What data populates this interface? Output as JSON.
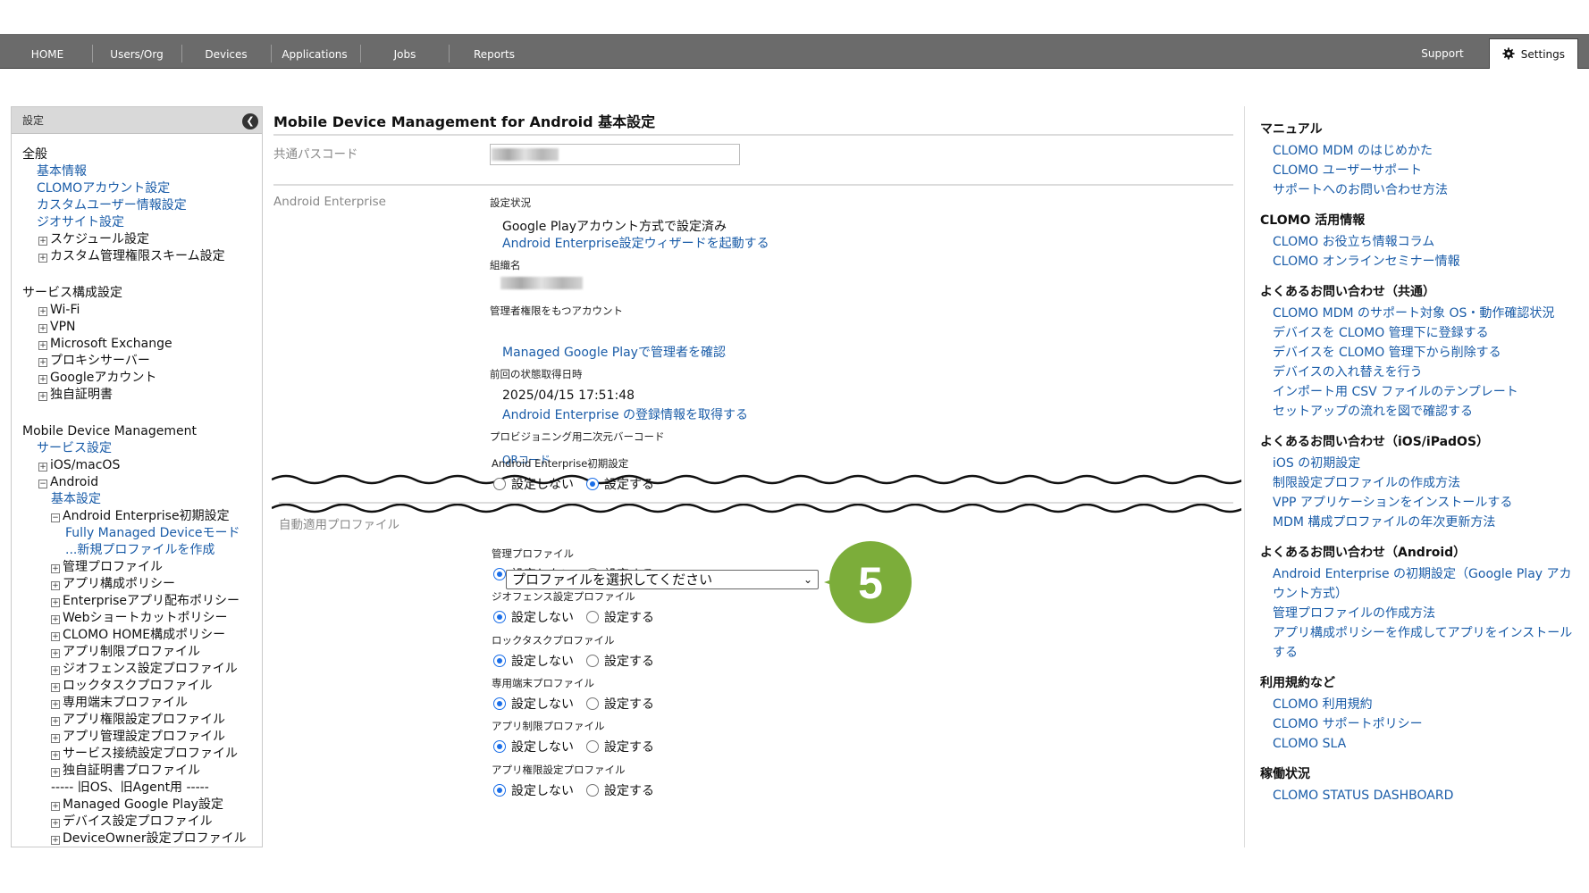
{
  "nav": {
    "items": [
      "HOME",
      "Users/Org",
      "Devices",
      "Applications",
      "Jobs",
      "Reports"
    ],
    "support": "Support",
    "settings": "Settings"
  },
  "sidebar": {
    "title": "設定",
    "sections": [
      {
        "label": "全般",
        "items": [
          {
            "label": "基本情報",
            "level": 1,
            "kind": "link"
          },
          {
            "label": "CLOMOアカウント設定",
            "level": 1,
            "kind": "link"
          },
          {
            "label": "カスタムユーザー情報設定",
            "level": 1,
            "kind": "link"
          },
          {
            "label": "ジオサイト設定",
            "level": 1,
            "kind": "link"
          },
          {
            "label": "スケジュール設定",
            "level": 1,
            "kind": "plus"
          },
          {
            "label": "カスタム管理権限スキーム設定",
            "level": 1,
            "kind": "plus"
          }
        ]
      },
      {
        "label": "サービス構成設定",
        "items": [
          {
            "label": "Wi-Fi",
            "level": 1,
            "kind": "plus"
          },
          {
            "label": "VPN",
            "level": 1,
            "kind": "plus"
          },
          {
            "label": "Microsoft Exchange",
            "level": 1,
            "kind": "plus"
          },
          {
            "label": "プロキシサーバー",
            "level": 1,
            "kind": "plus"
          },
          {
            "label": "Googleアカウント",
            "level": 1,
            "kind": "plus"
          },
          {
            "label": "独自証明書",
            "level": 1,
            "kind": "plus"
          }
        ]
      },
      {
        "label": "Mobile Device Management",
        "items": [
          {
            "label": "サービス設定",
            "level": 1,
            "kind": "link"
          },
          {
            "label": "iOS/macOS",
            "level": 1,
            "kind": "plus"
          },
          {
            "label": "Android",
            "level": 1,
            "kind": "minus"
          },
          {
            "label": "基本設定",
            "level": 2,
            "kind": "link"
          },
          {
            "label": "Android Enterprise初期設定",
            "level": 2,
            "kind": "minus"
          },
          {
            "label": "Fully Managed Deviceモード",
            "level": 3,
            "kind": "link"
          },
          {
            "label": "...新規プロファイルを作成",
            "level": 3,
            "kind": "link"
          },
          {
            "label": "管理プロファイル",
            "level": 2,
            "kind": "plus"
          },
          {
            "label": "アプリ構成ポリシー",
            "level": 2,
            "kind": "plus"
          },
          {
            "label": "Enterpriseアプリ配布ポリシー",
            "level": 2,
            "kind": "plus"
          },
          {
            "label": "Webショートカットポリシー",
            "level": 2,
            "kind": "plus"
          },
          {
            "label": "CLOMO HOME構成ポリシー",
            "level": 2,
            "kind": "plus"
          },
          {
            "label": "アプリ制限プロファイル",
            "level": 2,
            "kind": "plus"
          },
          {
            "label": "ジオフェンス設定プロファイル",
            "level": 2,
            "kind": "plus"
          },
          {
            "label": "ロックタスクプロファイル",
            "level": 2,
            "kind": "plus"
          },
          {
            "label": "専用端末プロファイル",
            "level": 2,
            "kind": "plus"
          },
          {
            "label": "アプリ権限設定プロファイル",
            "level": 2,
            "kind": "plus"
          },
          {
            "label": "アプリ管理設定プロファイル",
            "level": 2,
            "kind": "plus"
          },
          {
            "label": "サービス接続設定プロファイル",
            "level": 2,
            "kind": "plus"
          },
          {
            "label": "独自証明書プロファイル",
            "level": 2,
            "kind": "plus"
          },
          {
            "label": "----- 旧OS、旧Agent用 -----",
            "level": 2,
            "kind": "text"
          },
          {
            "label": "Managed Google Play設定",
            "level": 2,
            "kind": "plus"
          },
          {
            "label": "デバイス設定プロファイル",
            "level": 2,
            "kind": "plus"
          },
          {
            "label": "DeviceOwner設定プロファイル",
            "level": 2,
            "kind": "plus"
          }
        ]
      }
    ]
  },
  "main": {
    "title": "Mobile Device Management for Android 基本設定",
    "passcode_label": "共通パスコード",
    "ae_label": "Android Enterprise",
    "status_label": "設定状況",
    "status_value": "Google Playアカウント方式で設定済み",
    "wizard_link": "Android Enterprise設定ウィザードを起動する",
    "org_label": "組織名",
    "admin_label": "管理者権限をもつアカウント",
    "admin_link": "Managed Google Playで管理者を確認",
    "last_label": "前回の状態取得日時",
    "last_value": "2025/04/15 17:51:48",
    "last_link": "Android Enterprise の登録情報を取得する",
    "qr_label": "プロビジョニング用二次元バーコード",
    "qr_link": "QRコード",
    "auto_label": "自動適用プロファイル",
    "opt_off": "設定しない",
    "opt_on": "設定する",
    "select_placeholder": "プロファイルを選択してください",
    "step_number": "5",
    "accent_color": "#7cad3a",
    "profiles": [
      {
        "name": "Android Enterprise初期設定",
        "selected": "on"
      },
      {
        "name": "管理プロファイル",
        "selected": "off"
      },
      {
        "name": "ジオフェンス設定プロファイル",
        "selected": "off"
      },
      {
        "name": "ロックタスクプロファイル",
        "selected": "off"
      },
      {
        "name": "専用端末プロファイル",
        "selected": "off"
      },
      {
        "name": "アプリ制限プロファイル",
        "selected": "off"
      },
      {
        "name": "アプリ権限設定プロファイル",
        "selected": "off"
      }
    ]
  },
  "right": [
    {
      "head": "マニュアル",
      "links": [
        "CLOMO MDM のはじめかた",
        "CLOMO ユーザーサポート",
        "サポートへのお問い合わせ方法"
      ]
    },
    {
      "head": "CLOMO 活用情報",
      "links": [
        "CLOMO お役立ち情報コラム",
        "CLOMO オンラインセミナー情報"
      ]
    },
    {
      "head": "よくあるお問い合わせ（共通）",
      "links": [
        "CLOMO MDM のサポート対象 OS・動作確認状況",
        "デバイスを CLOMO 管理下に登録する",
        "デバイスを CLOMO 管理下から削除する",
        "デバイスの入れ替えを行う",
        "インポート用 CSV ファイルのテンプレート",
        "セットアップの流れを図で確認する"
      ]
    },
    {
      "head": "よくあるお問い合わせ（iOS/iPadOS）",
      "links": [
        "iOS の初期設定",
        "制限設定プロファイルの作成方法",
        "VPP アプリケーションをインストールする",
        "MDM 構成プロファイルの年次更新方法"
      ]
    },
    {
      "head": "よくあるお問い合わせ（Android）",
      "links": [
        "Android Enterprise の初期設定（Google Play アカウント方式）",
        "管理プロファイルの作成方法",
        "アプリ構成ポリシーを作成してアプリをインストールする"
      ]
    },
    {
      "head": "利用規約など",
      "links": [
        "CLOMO 利用規約",
        "CLOMO サポートポリシー",
        "CLOMO SLA"
      ]
    },
    {
      "head": "稼働状況",
      "links": [
        "CLOMO STATUS DASHBOARD"
      ]
    }
  ]
}
